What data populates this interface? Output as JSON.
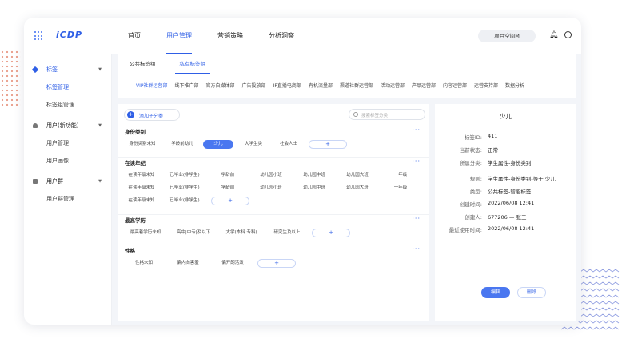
{
  "app": {
    "logo": "iCDP"
  },
  "nav": {
    "items": [
      "首页",
      "用户管理",
      "营销策略",
      "分析洞察"
    ],
    "active_index": 1
  },
  "header": {
    "project": "项目空间M"
  },
  "sidebar": {
    "groups": [
      {
        "label": "标签",
        "subitems": [
          "标签管理",
          "标签组管理"
        ]
      },
      {
        "label": "用户(新功能)",
        "subitems": [
          "用户管理",
          "用户画像"
        ]
      },
      {
        "label": "用户群",
        "subitems": [
          "用户群管理"
        ]
      }
    ]
  },
  "tabs": {
    "primary": [
      "公共标签组",
      "私有标签组"
    ]
  },
  "departments": [
    "VIP社群运营部",
    "线下推广部",
    "官方自媒体部",
    "广告投放部",
    "IP直播电商部",
    "有机流量部",
    "渠道社群运营部",
    "活动运营部",
    "产品运营部",
    "内容运营部",
    "运营支持部",
    "数据分析"
  ],
  "toolbar": {
    "add_label": "添加子分类",
    "search_placeholder": "搜索标签分类"
  },
  "categories": [
    {
      "name": "身份类别",
      "tags": [
        "身份类别未知",
        "学龄前幼儿",
        "少儿",
        "大学生类",
        "社会人士"
      ]
    },
    {
      "name": "在读年纪",
      "tags": [
        "在读年级未知",
        "已毕业(非学生)",
        "学龄前",
        "幼儿园小班",
        "幼儿园中班",
        "幼儿园大班",
        "一年级",
        "在读年级未知",
        "已毕业(非学生)",
        "学龄前",
        "幼儿园小班",
        "幼儿园中班",
        "幼儿园大班",
        "一年级",
        "在读年级未知",
        "已毕业(非学生)"
      ]
    },
    {
      "name": "最高学历",
      "tags": [
        "最高着学历未知",
        "高中|中专|及以下",
        "大学(本科 专科)",
        "研究生及以上"
      ]
    },
    {
      "name": "性格",
      "tags": [
        "性格未知",
        "偏内向害羞",
        "偏开朗活泼"
      ]
    }
  ],
  "detail": {
    "title": "少儿",
    "fields": [
      {
        "key": "标签ID:",
        "value": "411"
      },
      {
        "key": "当前状态:",
        "value": "正常"
      },
      {
        "key": "所属分类:",
        "value": "学生属性-身份类别"
      },
      {
        "key": "规则:",
        "value": "学生属性-身份类别-等于  少儿"
      },
      {
        "key": "类型:",
        "value": "公共标签-智能标签"
      },
      {
        "key": "创建时间:",
        "value": "2022/06/08 12:41"
      },
      {
        "key": "创建人:",
        "value": "677206 — 张三"
      },
      {
        "key": "最近使用时间:",
        "value": "2022/06/08 12:41"
      }
    ],
    "edit_label": "编辑",
    "delete_label": "删除"
  },
  "colors": {
    "accent": "#2f5fe6",
    "chip_selected": "#4a77f0",
    "decor_dots": "#e89a86",
    "decor_zigzag": "#6d7fd8"
  }
}
